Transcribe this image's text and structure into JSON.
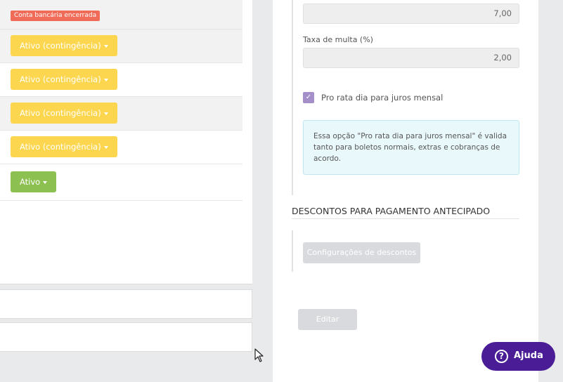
{
  "left": {
    "closed_badge": "Conta bancária encerrada",
    "rows": [
      {
        "status": "Ativo (contingência)",
        "kind": "warn"
      },
      {
        "status": "Ativo (contingência)",
        "kind": "warn"
      },
      {
        "status": "Ativo (contingência)",
        "kind": "warn"
      },
      {
        "status": "Ativo (contingência)",
        "kind": "warn"
      },
      {
        "status": "Ativo",
        "kind": "ok"
      }
    ]
  },
  "right": {
    "field_top_value": "7,00",
    "fine_rate_label": "Taxa de multa (%)",
    "fine_rate_value": "2,00",
    "pro_rata_checked": true,
    "pro_rata_label": "Pro rata dia para juros mensal",
    "info_text": "Essa opção \"Pro rata dia para juros mensal\" é valida tanto para boletos normais, extras e cobranças de acordo.",
    "discounts_title": "DESCONTOS PARA PAGAMENTO ANTECIPADO",
    "discounts_button": "Configurações de descontos",
    "edit_button": "Editar"
  },
  "help": {
    "label": "Ajuda"
  },
  "colors": {
    "warn": "#fcd64f",
    "ok": "#8cc152",
    "badge": "#f06c58",
    "checkbox": "#a48fc9",
    "help": "#4a1d96"
  }
}
